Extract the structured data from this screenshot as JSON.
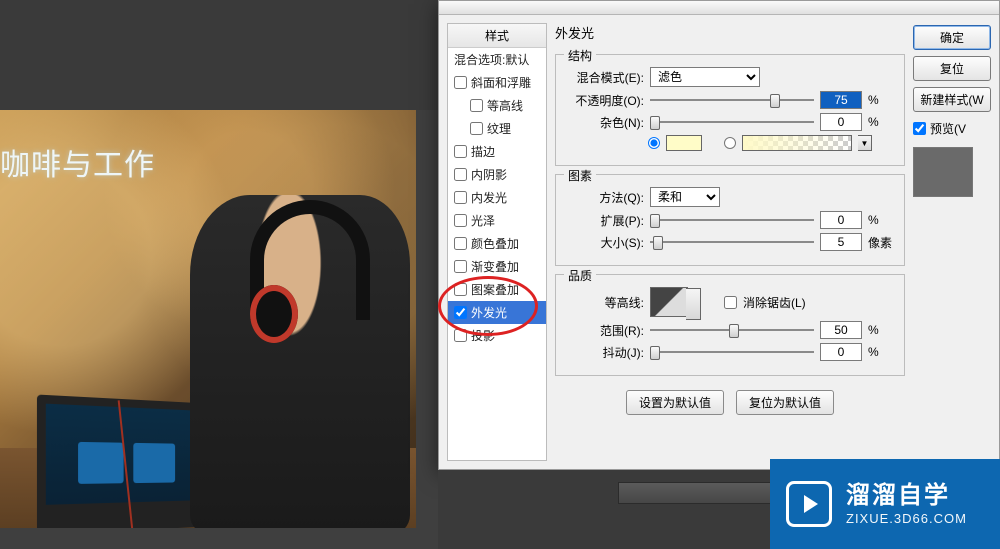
{
  "canvas": {
    "overlay_text": "咖啡与工作"
  },
  "dialog": {
    "title": "",
    "panel_header": "外发光",
    "styles_list": {
      "header": "样式",
      "blend_options": "混合选项:默认",
      "items": [
        {
          "label": "斜面和浮雕",
          "checked": false
        },
        {
          "label": "等高线",
          "checked": false,
          "sub": true
        },
        {
          "label": "纹理",
          "checked": false,
          "sub": true
        },
        {
          "label": "描边",
          "checked": false
        },
        {
          "label": "内阴影",
          "checked": false
        },
        {
          "label": "内发光",
          "checked": false
        },
        {
          "label": "光泽",
          "checked": false
        },
        {
          "label": "颜色叠加",
          "checked": false
        },
        {
          "label": "渐变叠加",
          "checked": false
        },
        {
          "label": "图案叠加",
          "checked": false
        },
        {
          "label": "外发光",
          "checked": true,
          "selected": true
        },
        {
          "label": "投影",
          "checked": false
        }
      ]
    },
    "structure": {
      "legend": "结构",
      "blend_mode_label": "混合模式(E):",
      "blend_mode_value": "滤色",
      "opacity_label": "不透明度(O):",
      "opacity_value": "75",
      "opacity_unit": "%",
      "noise_label": "杂色(N):",
      "noise_value": "0",
      "noise_unit": "%",
      "color_radio_selected": "solid"
    },
    "elements": {
      "legend": "图素",
      "technique_label": "方法(Q):",
      "technique_value": "柔和",
      "spread_label": "扩展(P):",
      "spread_value": "0",
      "spread_unit": "%",
      "size_label": "大小(S):",
      "size_value": "5",
      "size_unit": "像素"
    },
    "quality": {
      "legend": "品质",
      "contour_label": "等高线:",
      "antialias_label": "消除锯齿(L)",
      "antialias_checked": false,
      "range_label": "范围(R):",
      "range_value": "50",
      "range_unit": "%",
      "jitter_label": "抖动(J):",
      "jitter_value": "0",
      "jitter_unit": "%"
    },
    "bottom_buttons": {
      "make_default": "设置为默认值",
      "reset_default": "复位为默认值"
    },
    "right": {
      "ok": "确定",
      "cancel": "复位",
      "new_style": "新建样式(W",
      "preview_label": "预览(V"
    }
  },
  "watermark": {
    "cn": "溜溜自学",
    "en": "ZIXUE.3D66.COM"
  }
}
